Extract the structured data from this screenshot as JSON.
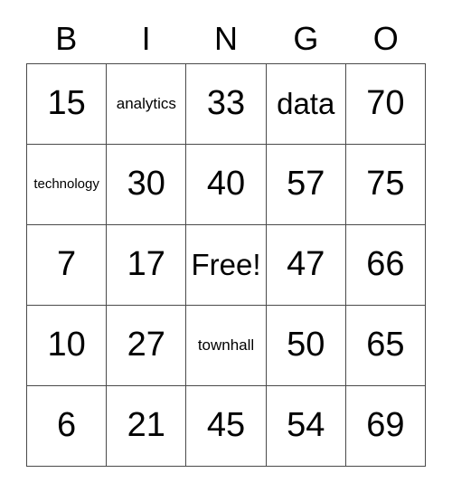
{
  "card": {
    "title": "BINGO",
    "headers": [
      "B",
      "I",
      "N",
      "G",
      "O"
    ],
    "free_space_label": "Free!",
    "rows": [
      [
        {
          "text": "15",
          "size": "num"
        },
        {
          "text": "analytics",
          "size": "small"
        },
        {
          "text": "33",
          "size": "num"
        },
        {
          "text": "data",
          "size": "word"
        },
        {
          "text": "70",
          "size": "num"
        }
      ],
      [
        {
          "text": "technology",
          "size": "tiny"
        },
        {
          "text": "30",
          "size": "num"
        },
        {
          "text": "40",
          "size": "num"
        },
        {
          "text": "57",
          "size": "num"
        },
        {
          "text": "75",
          "size": "num"
        }
      ],
      [
        {
          "text": "7",
          "size": "num"
        },
        {
          "text": "17",
          "size": "num"
        },
        {
          "text": "Free!",
          "size": "word"
        },
        {
          "text": "47",
          "size": "num"
        },
        {
          "text": "66",
          "size": "num"
        }
      ],
      [
        {
          "text": "10",
          "size": "num"
        },
        {
          "text": "27",
          "size": "num"
        },
        {
          "text": "townhall",
          "size": "small"
        },
        {
          "text": "50",
          "size": "num"
        },
        {
          "text": "65",
          "size": "num"
        }
      ],
      [
        {
          "text": "6",
          "size": "num"
        },
        {
          "text": "21",
          "size": "num"
        },
        {
          "text": "45",
          "size": "num"
        },
        {
          "text": "54",
          "size": "num"
        },
        {
          "text": "69",
          "size": "num"
        }
      ]
    ]
  },
  "colors": {
    "background": "#ffffff",
    "text": "#000000",
    "grid_line": "#4a4a4a"
  }
}
